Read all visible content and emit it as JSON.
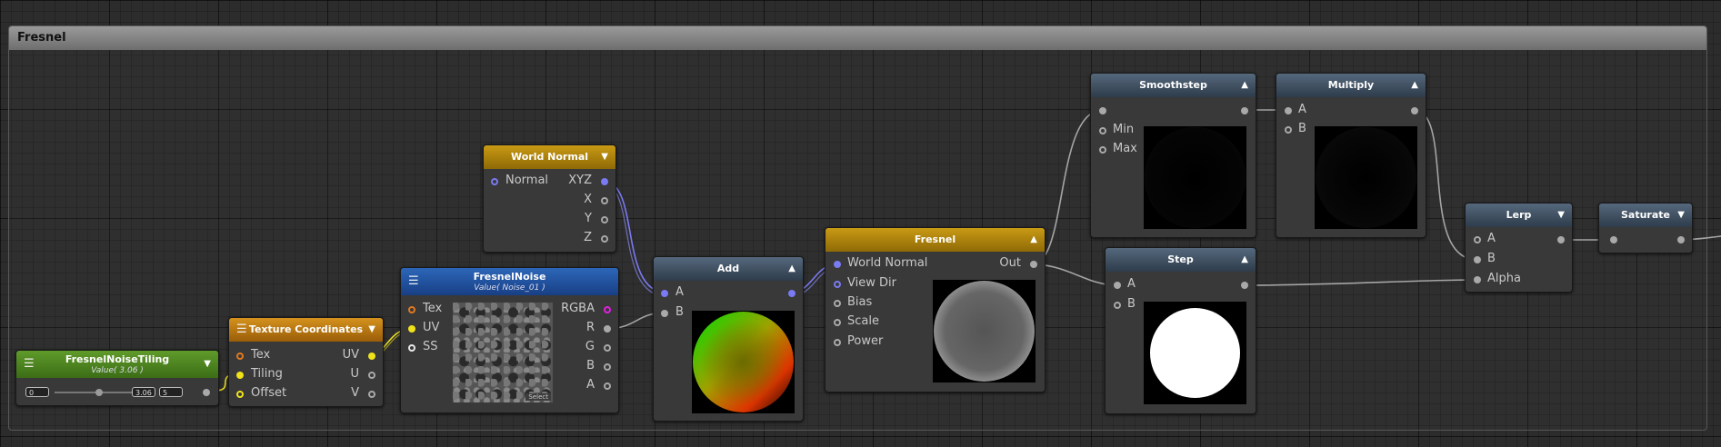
{
  "group": {
    "title": "Fresnel"
  },
  "nodes": {
    "tiling": {
      "title": "FresnelNoiseTiling",
      "subtitle": "Value( 3.06 )",
      "min": "0",
      "value": "3.06",
      "max": "5"
    },
    "texcoord": {
      "title": "Texture Coordinates",
      "inputs": [
        "Tex",
        "Tiling",
        "Offset"
      ],
      "outputs": [
        "UV",
        "U",
        "V"
      ]
    },
    "noise": {
      "title": "FresnelNoise",
      "subtitle": "Value( Noise_01 )",
      "inputs": [
        "Tex",
        "UV",
        "SS"
      ],
      "outputs": [
        "RGBA",
        "R",
        "G",
        "B",
        "A"
      ],
      "select_label": "Select"
    },
    "worldnormal": {
      "title": "World Normal",
      "input": "Normal",
      "outputs": [
        "XYZ",
        "X",
        "Y",
        "Z"
      ]
    },
    "add": {
      "title": "Add",
      "inputs": [
        "A",
        "B"
      ]
    },
    "fresnel": {
      "title": "Fresnel",
      "inputs": [
        "World Normal",
        "View Dir",
        "Bias",
        "Scale",
        "Power"
      ],
      "output": "Out"
    },
    "smoothstep": {
      "title": "Smoothstep",
      "inputs": [
        "Min",
        "Max"
      ]
    },
    "multiply": {
      "title": "Multiply",
      "inputs": [
        "A",
        "B"
      ]
    },
    "step": {
      "title": "Step",
      "inputs": [
        "A",
        "B"
      ]
    },
    "lerp": {
      "title": "Lerp",
      "inputs": [
        "A",
        "B",
        "Alpha"
      ]
    },
    "saturate": {
      "title": "Saturate"
    }
  },
  "icons": {
    "collapse": "triangle-up-icon",
    "expand": "triangle-down-icon",
    "menu": "hamburger-menu-icon"
  },
  "colors": {
    "float_port": "#a9a9a9",
    "vector_port": "#7a7af2",
    "uv_port": "#f0e21a",
    "texture_port": "#e07a20",
    "rgba_port": "#e020e0"
  }
}
